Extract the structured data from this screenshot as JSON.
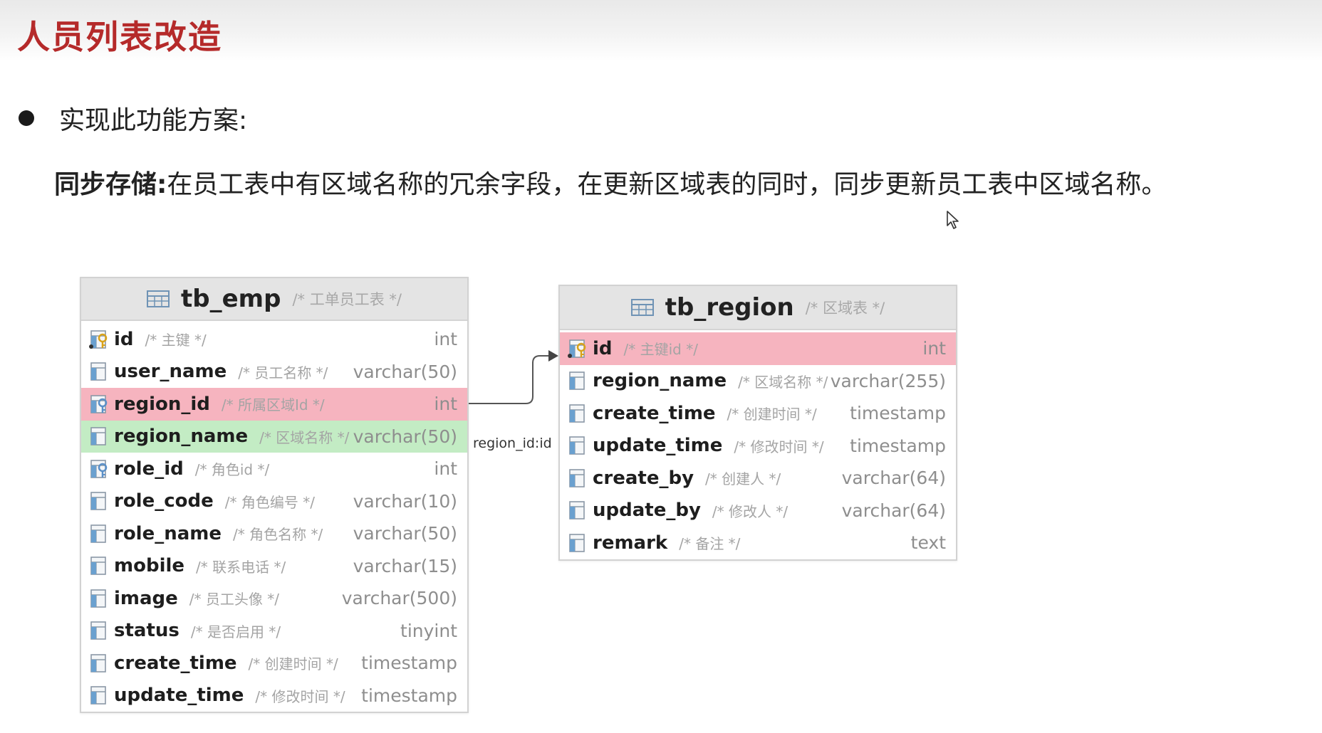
{
  "page": {
    "title": "人员列表改造"
  },
  "bullet": {
    "text": "实现此功能方案:"
  },
  "description": {
    "label": "同步存储:",
    "text": "在员工表中有区域名称的冗余字段，在更新区域表的同时，同步更新员工表中区域名称。"
  },
  "relation": {
    "label": "region_id:id"
  },
  "colors": {
    "title": "#b52a2a",
    "highlight_fk": "#f6b4bf",
    "highlight_new": "#c3ecc4"
  },
  "tables": {
    "emp": {
      "name": "tb_emp",
      "comment": "/* 工单员工表 */",
      "columns": [
        {
          "name": "id",
          "comment": "/* 主键 */",
          "type": "int",
          "icon": "primary-key-icon"
        },
        {
          "name": "user_name",
          "comment": "/* 员工名称 */",
          "type": "varchar(50)",
          "icon": "column-icon"
        },
        {
          "name": "region_id",
          "comment": "/* 所属区域Id */",
          "type": "int",
          "icon": "foreign-key-icon"
        },
        {
          "name": "region_name",
          "comment": "/* 区域名称 */",
          "type": "varchar(50)",
          "icon": "column-icon"
        },
        {
          "name": "role_id",
          "comment": "/* 角色id */",
          "type": "int",
          "icon": "foreign-key-icon"
        },
        {
          "name": "role_code",
          "comment": "/* 角色编号 */",
          "type": "varchar(10)",
          "icon": "column-icon"
        },
        {
          "name": "role_name",
          "comment": "/* 角色名称 */",
          "type": "varchar(50)",
          "icon": "column-icon"
        },
        {
          "name": "mobile",
          "comment": "/* 联系电话 */",
          "type": "varchar(15)",
          "icon": "column-icon"
        },
        {
          "name": "image",
          "comment": "/* 员工头像 */",
          "type": "varchar(500)",
          "icon": "column-icon"
        },
        {
          "name": "status",
          "comment": "/* 是否启用 */",
          "type": "tinyint",
          "icon": "column-icon"
        },
        {
          "name": "create_time",
          "comment": "/* 创建时间 */",
          "type": "timestamp",
          "icon": "column-icon"
        },
        {
          "name": "update_time",
          "comment": "/* 修改时间 */",
          "type": "timestamp",
          "icon": "column-icon"
        }
      ]
    },
    "region": {
      "name": "tb_region",
      "comment": "/* 区域表 */",
      "columns": [
        {
          "name": "id",
          "comment": "/* 主键id */",
          "type": "int",
          "icon": "primary-key-icon"
        },
        {
          "name": "region_name",
          "comment": "/* 区域名称 */",
          "type": "varchar(255)",
          "icon": "column-icon"
        },
        {
          "name": "create_time",
          "comment": "/* 创建时间 */",
          "type": "timestamp",
          "icon": "column-icon"
        },
        {
          "name": "update_time",
          "comment": "/* 修改时间 */",
          "type": "timestamp",
          "icon": "column-icon"
        },
        {
          "name": "create_by",
          "comment": "/* 创建人 */",
          "type": "varchar(64)",
          "icon": "column-icon"
        },
        {
          "name": "update_by",
          "comment": "/* 修改人 */",
          "type": "varchar(64)",
          "icon": "column-icon"
        },
        {
          "name": "remark",
          "comment": "/* 备注 */",
          "type": "text",
          "icon": "column-icon"
        }
      ]
    }
  }
}
